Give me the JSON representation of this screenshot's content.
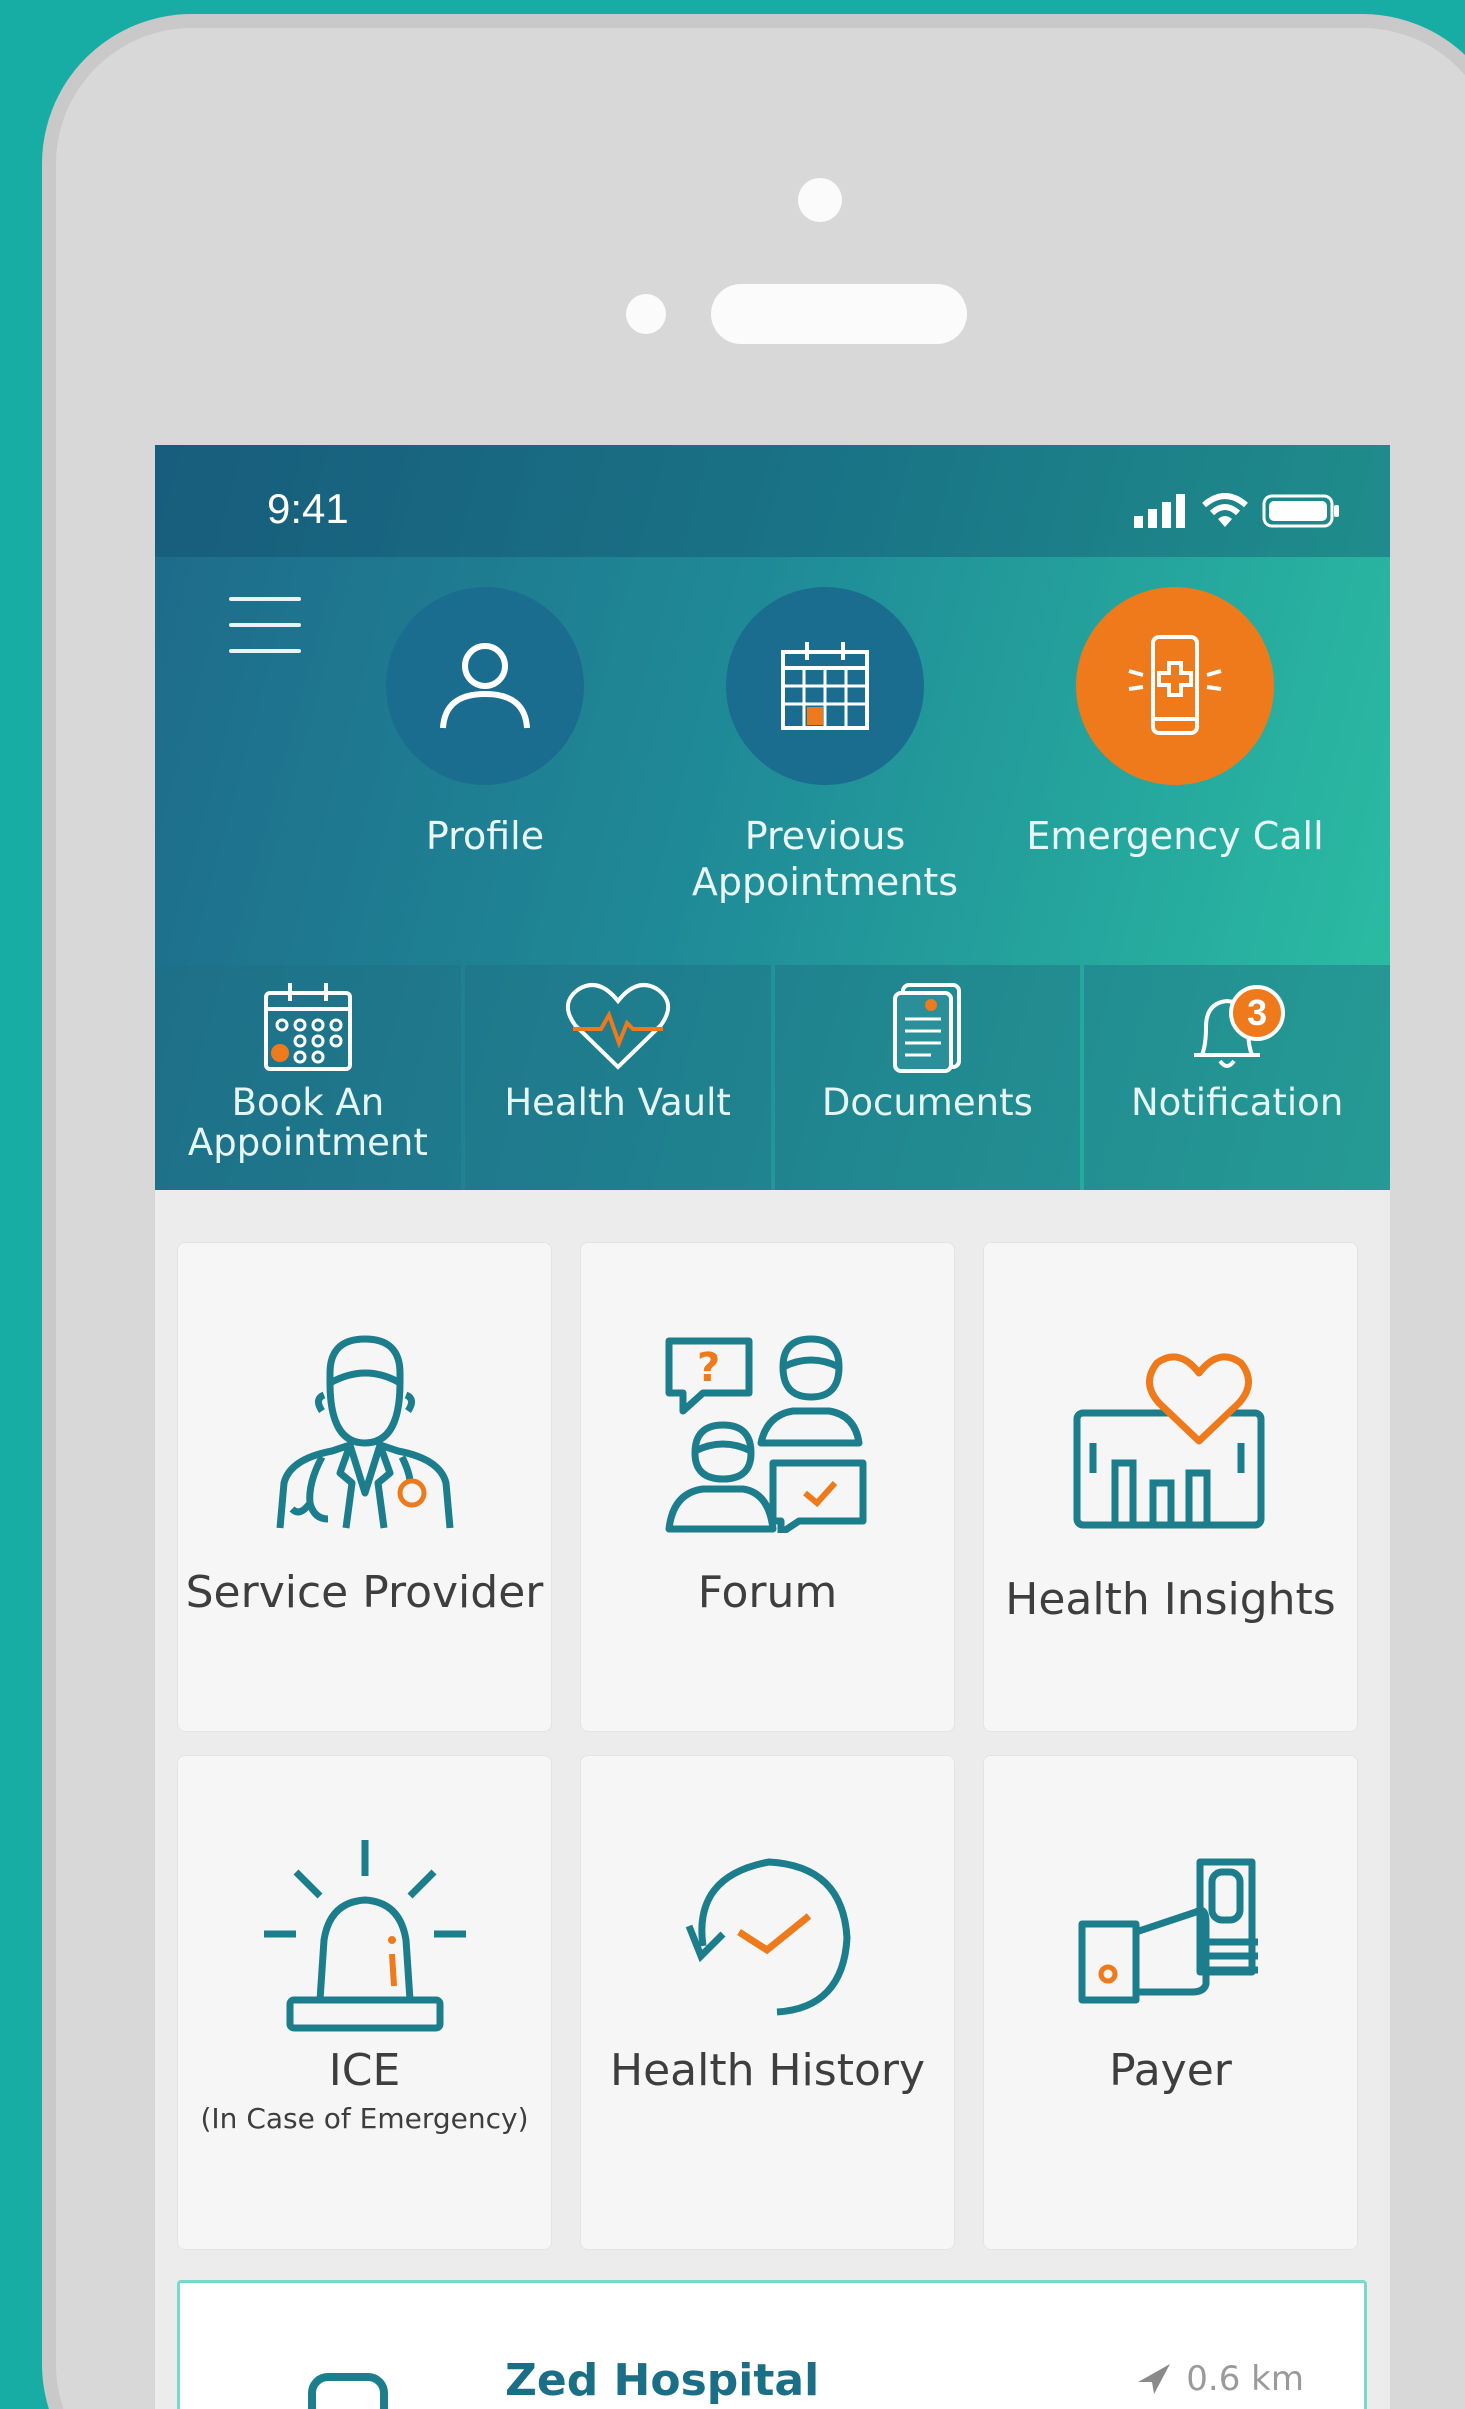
{
  "status_bar": {
    "time": "9:41"
  },
  "top_actions": [
    {
      "label": "Profile",
      "icon": "profile-icon"
    },
    {
      "label": "Previous Appointments",
      "icon": "calendar-icon"
    },
    {
      "label": "Emergency Call",
      "icon": "emergency-phone-icon"
    }
  ],
  "quick_actions": [
    {
      "label": "Book An Appointment",
      "icon": "calendar-icon"
    },
    {
      "label": "Health Vault",
      "icon": "heart-pulse-icon"
    },
    {
      "label": "Documents",
      "icon": "document-icon"
    },
    {
      "label": "Notification",
      "icon": "bell-icon",
      "badge": "3"
    }
  ],
  "tiles": [
    {
      "label": "Service Provider",
      "icon": "doctor-icon"
    },
    {
      "label": "Forum",
      "icon": "forum-icon"
    },
    {
      "label": "Health Insights",
      "icon": "insights-icon"
    },
    {
      "label": "ICE",
      "sublabel": "(In Case of Emergency)",
      "icon": "siren-icon"
    },
    {
      "label": "Health History",
      "icon": "history-icon"
    },
    {
      "label": "Payer",
      "icon": "payer-icon"
    }
  ],
  "hospital": {
    "name": "Zed Hospital",
    "distance": "0.6 km"
  },
  "colors": {
    "teal": "#17ada4",
    "accent": "#ee7a1c",
    "icon_teal": "#1c7d8c"
  }
}
